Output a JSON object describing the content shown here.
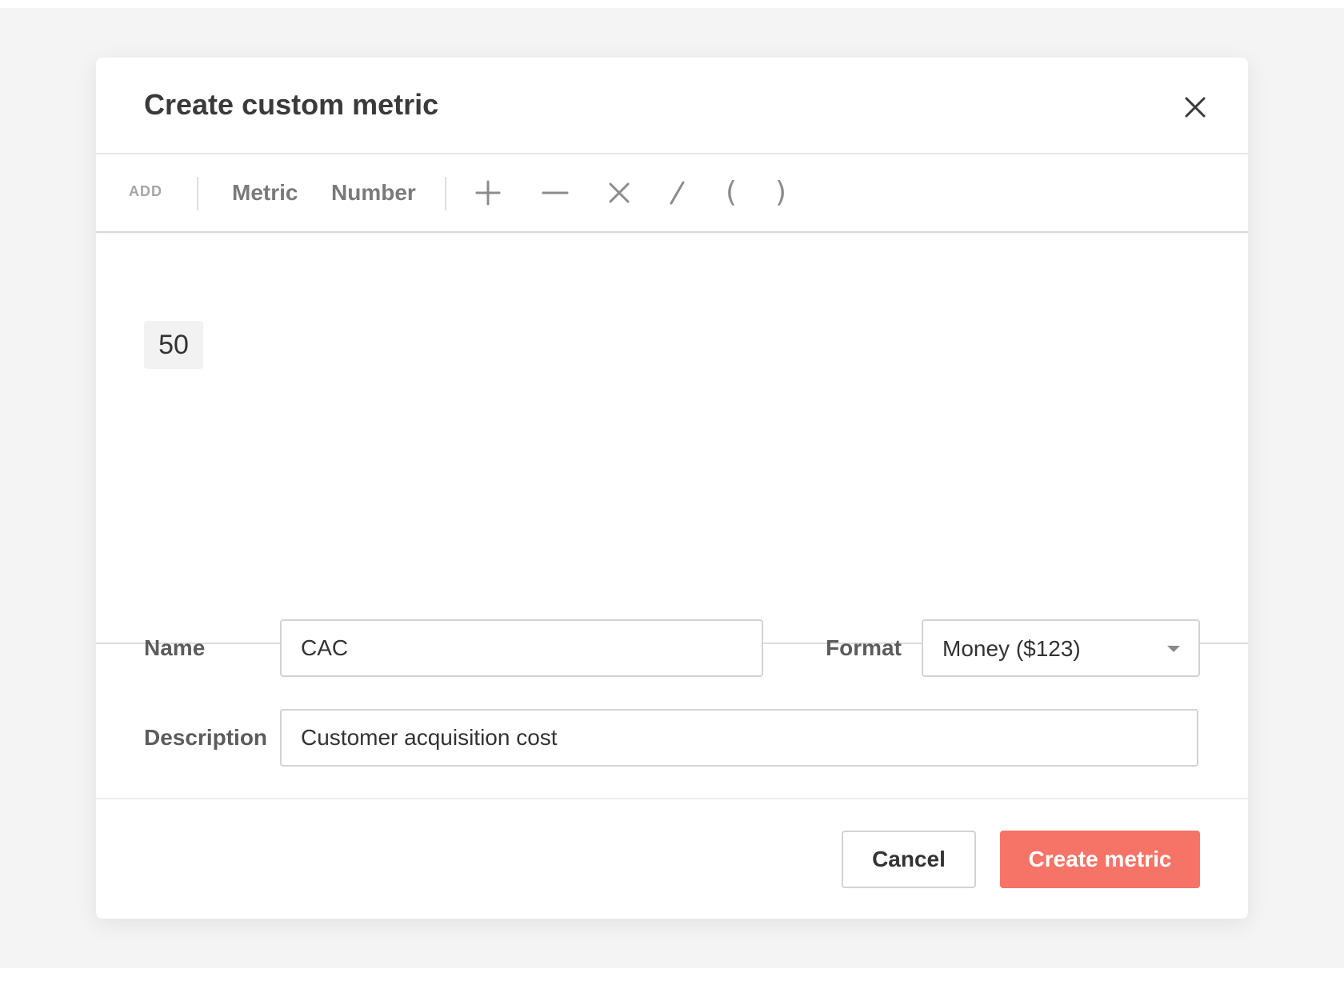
{
  "modal": {
    "title": "Create custom metric",
    "close_icon": "close-icon"
  },
  "toolbar": {
    "add_label": "ADD",
    "metric_label": "Metric",
    "number_label": "Number",
    "operators": {
      "plus": "plus-icon",
      "minus": "minus-icon",
      "multiply": "multiply-icon",
      "divide": "divide-icon",
      "open_paren": "(",
      "close_paren": ")"
    }
  },
  "formula": {
    "tokens": [
      "50"
    ]
  },
  "form": {
    "name_label": "Name",
    "name_value": "CAC",
    "format_label": "Format",
    "format_value": "Money ($123)",
    "format_caret_icon": "chevron-down-icon",
    "description_label": "Description",
    "description_value": "Customer acquisition cost"
  },
  "footer": {
    "cancel_label": "Cancel",
    "create_label": "Create metric"
  },
  "colors": {
    "primary": "#f67367",
    "backdrop": "#f4f4f5",
    "text": "#3a3a3a",
    "muted": "#7a7a7a"
  }
}
